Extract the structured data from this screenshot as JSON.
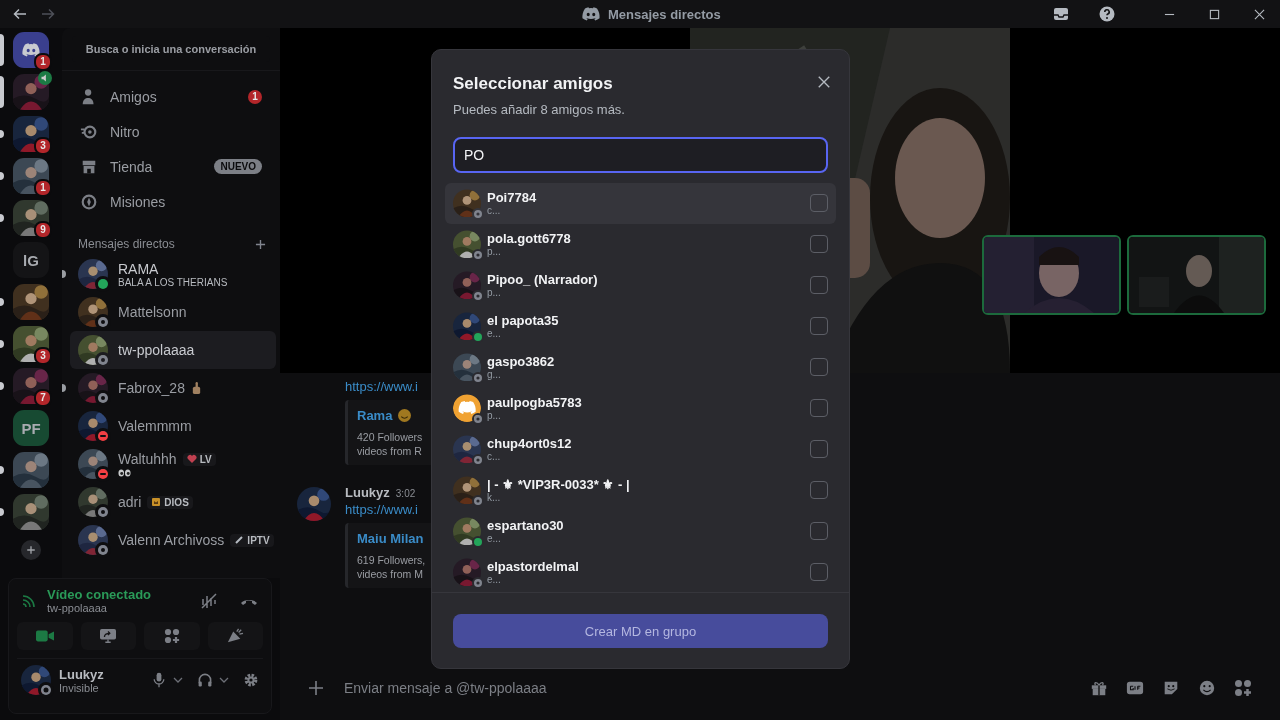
{
  "titlebar": {
    "title": "Mensajes directos"
  },
  "servers": [
    {
      "kind": "home",
      "badge": "1",
      "selected": true,
      "unread": true
    },
    {
      "kind": "picture",
      "voice": true,
      "selected": true,
      "unread": true
    },
    {
      "kind": "picture",
      "badge": "3",
      "selected": false,
      "unread": true
    },
    {
      "kind": "picture",
      "badge": "1",
      "selected": false,
      "unread": true
    },
    {
      "kind": "picture",
      "badge": "9",
      "selected": false,
      "unread": true
    },
    {
      "kind": "text",
      "label": "lG",
      "color": "#141416",
      "selected": false,
      "unread": false
    },
    {
      "kind": "picture",
      "selected": false,
      "unread": true
    },
    {
      "kind": "picture",
      "badge": "3",
      "selected": false,
      "unread": true
    },
    {
      "kind": "picture",
      "badge": "7",
      "selected": false,
      "unread": true
    },
    {
      "kind": "text",
      "label": "PF",
      "color": "#174a32",
      "selected": false,
      "unread": false
    },
    {
      "kind": "picture",
      "selected": false,
      "unread": true
    },
    {
      "kind": "picture",
      "selected": false,
      "unread": true
    }
  ],
  "sidebar": {
    "search": "Busca o inicia una conversación",
    "nav": [
      {
        "kind": "friends",
        "label": "Amigos",
        "badge": "1"
      },
      {
        "kind": "nitro",
        "label": "Nitro"
      },
      {
        "kind": "shop",
        "label": "Tienda",
        "tag": "NUEVO"
      },
      {
        "kind": "quests",
        "label": "Misiones"
      }
    ],
    "dm_header": "Mensajes directos",
    "dms": [
      {
        "name": "RAMA",
        "subtitle": "BALA A LOS THERIANS",
        "color": "#23a55a",
        "unread": true,
        "selected": false
      },
      {
        "name": "Mattelsonn",
        "color": "#80848e",
        "unread": false,
        "selected": false
      },
      {
        "name": "tw-ppolaaaa",
        "color": "#80848e",
        "unread": false,
        "selected": true
      },
      {
        "name": "Fabrox_28",
        "hand_emoji": true,
        "color": "#80848e",
        "unread": true,
        "selected": false
      },
      {
        "name": "Valemmmm",
        "color": "#f23f43",
        "unread": false,
        "selected": false
      },
      {
        "name": "Waltuhhh",
        "tag": {
          "kind": "heart",
          "text": "LV"
        },
        "eyes_emoji": true,
        "color": "#f23f43",
        "unread": false,
        "selected": false
      },
      {
        "name": "adri",
        "tag": {
          "kind": "crown",
          "text": "DIOS"
        },
        "color": "#80848e",
        "unread": false,
        "selected": false
      },
      {
        "name": "Valenn Archivoss",
        "tag": {
          "kind": "pen",
          "text": "IPTV"
        },
        "color": "#80848e",
        "unread": false,
        "selected": false
      }
    ]
  },
  "voice": {
    "title": "Vídeo conectado",
    "channel": "tw-ppolaaaa",
    "camera_on": true
  },
  "user": {
    "name": "Luukyz",
    "status": "Invisible"
  },
  "chat": {
    "messages": [
      {
        "link": "https://www.i",
        "embed": {
          "title": "Rama",
          "title_emoji": true,
          "lines": [
            "420 Followers",
            "videos from R"
          ]
        }
      },
      {
        "author": "Luukyz",
        "time": "3:02",
        "link": "https://www.i",
        "embed": {
          "title": "Maiu Milan",
          "title_emoji": false,
          "lines": [
            "619 Followers,",
            "videos from M"
          ]
        }
      }
    ],
    "input_placeholder": "Enviar mensaje a @tw-ppolaaaa"
  },
  "modal": {
    "title": "Seleccionar amigos",
    "subtitle": "Puedes añadir 8 amigos más.",
    "search": {
      "value": "PO"
    },
    "friends": [
      {
        "name": "Poi7784",
        "sub": "c...",
        "color": "#80848e",
        "kind": "picture",
        "checked": false,
        "highlighted": true
      },
      {
        "name": "pola.gott6778",
        "sub": "p...",
        "color": "#80848e",
        "kind": "picture",
        "checked": false,
        "highlighted": false
      },
      {
        "name": "Pipoo_ (Narrador)",
        "sub": "p...",
        "color": "#80848e",
        "kind": "picture",
        "checked": false,
        "highlighted": false
      },
      {
        "name": "el papota35",
        "sub": "e...",
        "color": "#23a55a",
        "kind": "picture",
        "checked": false,
        "highlighted": false
      },
      {
        "name": "gaspo3862",
        "sub": "g...",
        "color": "#80848e",
        "kind": "picture",
        "checked": false,
        "highlighted": false
      },
      {
        "name": "paulpogba5783",
        "sub": "p...",
        "color": "#80848e",
        "kind": "default",
        "checked": false,
        "highlighted": false
      },
      {
        "name": "chup4ort0s12",
        "sub": "c...",
        "color": "#80848e",
        "kind": "picture",
        "checked": false,
        "highlighted": false
      },
      {
        "name": "| - ⚜ *VIP3R-0033* ⚜ - |",
        "sub": "k...",
        "color": "#80848e",
        "kind": "picture",
        "checked": false,
        "highlighted": false
      },
      {
        "name": "espartano30",
        "sub": "e...",
        "color": "#23a55a",
        "kind": "picture",
        "checked": false,
        "highlighted": false
      },
      {
        "name": "elpastordelmal",
        "sub": "e...",
        "color": "#80848e",
        "kind": "picture",
        "checked": false,
        "highlighted": false
      }
    ],
    "button": {
      "label": "Crear MD en grupo",
      "disabled": true
    }
  }
}
